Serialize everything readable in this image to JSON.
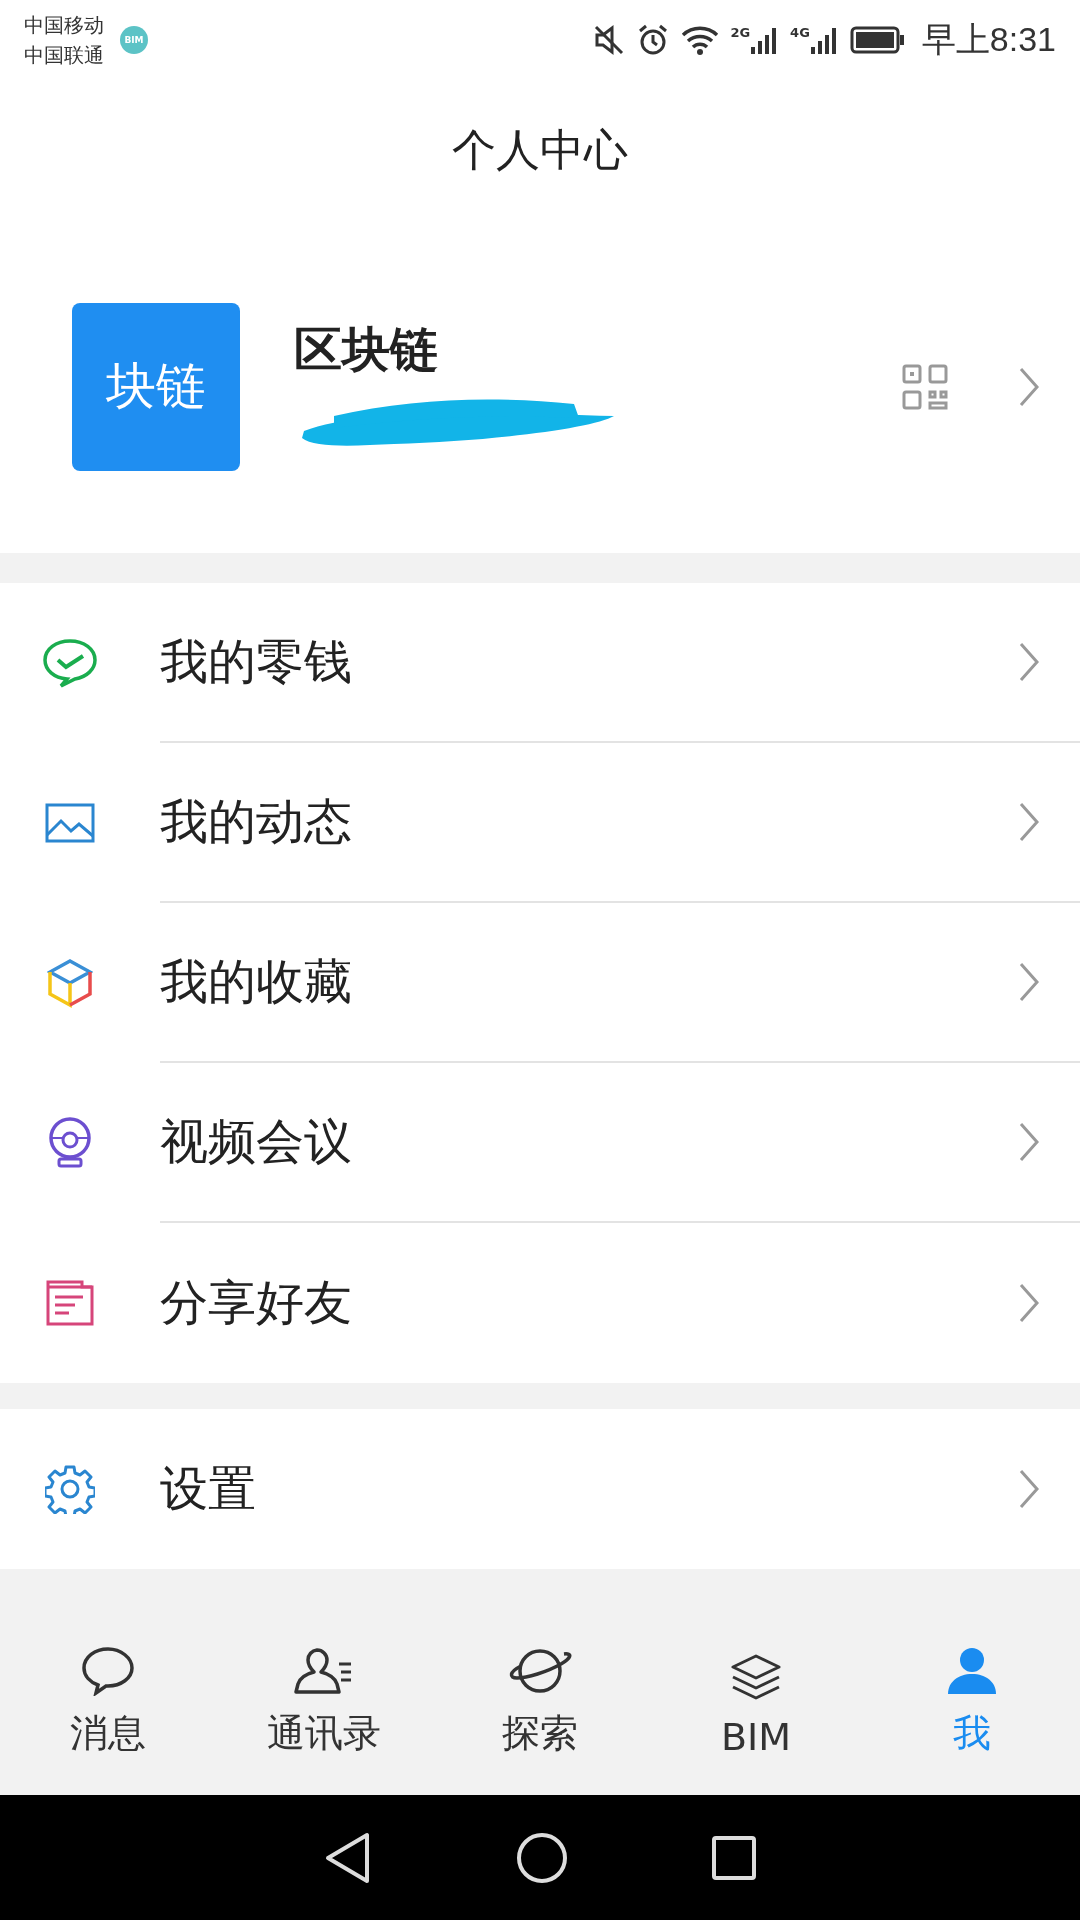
{
  "status_bar": {
    "carriers": [
      "中国移动",
      "中国联通"
    ],
    "notification_badge": "BIM",
    "network_labels": [
      "2G",
      "4G"
    ],
    "time": "早上8:31"
  },
  "header": {
    "title": "个人中心"
  },
  "profile": {
    "avatar_text": "块链",
    "name": "区块链"
  },
  "menu_groups": [
    [
      {
        "kind": "wallet",
        "label": "我的零钱"
      },
      {
        "kind": "moments",
        "label": "我的动态"
      },
      {
        "kind": "favorites",
        "label": "我的收藏"
      },
      {
        "kind": "video",
        "label": "视频会议"
      },
      {
        "kind": "share",
        "label": "分享好友"
      }
    ],
    [
      {
        "kind": "settings",
        "label": "设置"
      }
    ]
  ],
  "tab_bar": [
    {
      "kind": "messages",
      "label": "消息",
      "selected": false
    },
    {
      "kind": "contacts",
      "label": "通讯录",
      "selected": false
    },
    {
      "kind": "explore",
      "label": "探索",
      "selected": false
    },
    {
      "kind": "bim",
      "label": "BIM",
      "selected": false
    },
    {
      "kind": "me",
      "label": "我",
      "selected": true
    }
  ]
}
